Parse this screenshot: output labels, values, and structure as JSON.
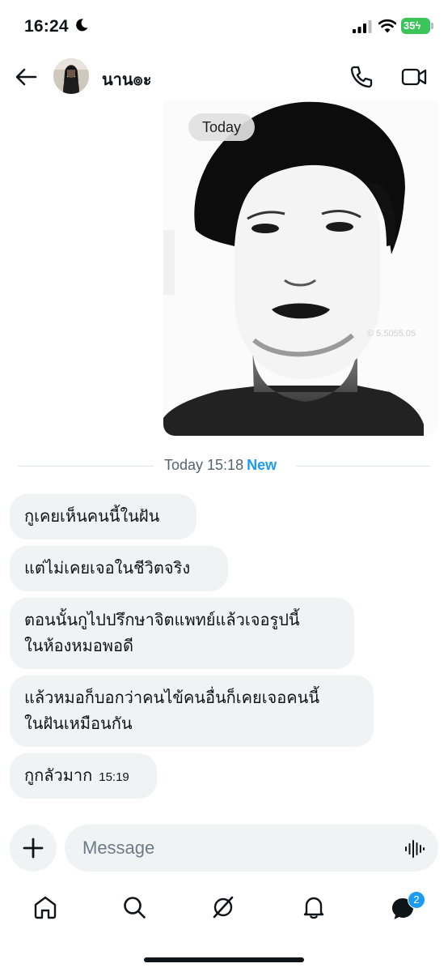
{
  "status_bar": {
    "time": "16:24",
    "battery": "35"
  },
  "header": {
    "contact_name": "นาน๏ะ"
  },
  "photo": {
    "watermark": "© 5.5055.05"
  },
  "chat": {
    "date_chip": "Today",
    "divider": {
      "label": "Today 15:18",
      "new_label": "New"
    },
    "messages": [
      {
        "text": "กูเคยเห็นคนนี้ในฝัน"
      },
      {
        "text": "แต่ไม่เคยเจอในชีวิตจริง"
      },
      {
        "line1": "ตอนนั้นกูไปปรึกษาจิตแพทย์แล้วเจอรูปนี้",
        "line2": "ในห้องหมอพอดี"
      },
      {
        "line1": "แล้วหมอก็บอกว่าคนไข้คนอื่นก็เคยเจอคนนี้",
        "line2": "ในฝันเหมือนกัน"
      },
      {
        "text": "กูกลัวมาก",
        "time": "15:19"
      }
    ]
  },
  "composer": {
    "placeholder": "Message"
  },
  "nav": {
    "messages_badge": "2"
  },
  "colors": {
    "accent": "#1d9bf0",
    "bubble": "#eff3f4",
    "battery": "#3ac45a"
  }
}
